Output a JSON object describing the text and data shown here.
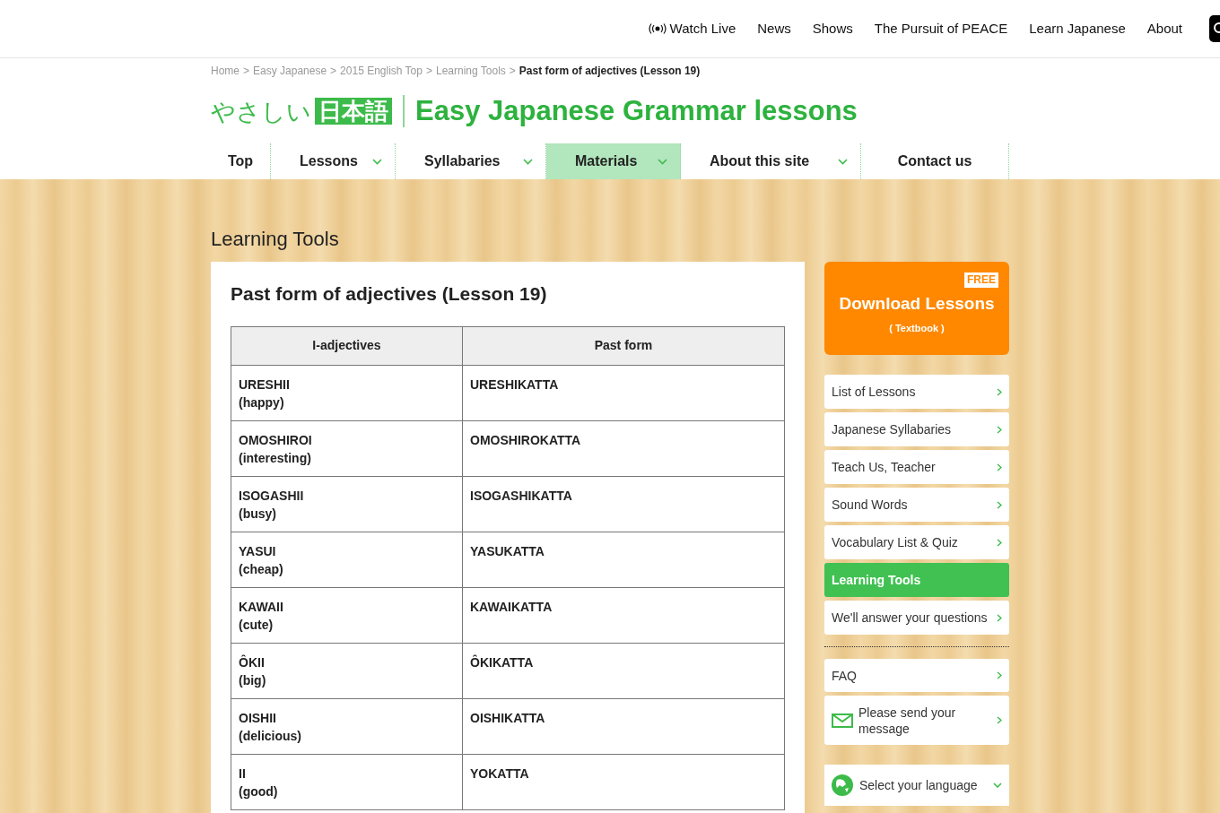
{
  "top_nav": {
    "items": [
      {
        "label": "Watch Live",
        "kind": "live"
      },
      {
        "label": "News",
        "kind": "plain"
      },
      {
        "label": "Shows",
        "kind": "plain"
      },
      {
        "label": "The Pursuit of PEACE",
        "kind": "plain"
      },
      {
        "label": "Learn Japanese",
        "kind": "plain"
      },
      {
        "label": "About",
        "kind": "plain"
      }
    ]
  },
  "breadcrumb": {
    "links": [
      "Home",
      "Easy Japanese",
      "2015 English Top",
      "Learning Tools"
    ],
    "separator": ">",
    "current": "Past form of adjectives (Lesson 19)"
  },
  "logo": {
    "kana": "やさしい",
    "kanji": "日本語"
  },
  "site_title": "Easy Japanese Grammar lessons",
  "menu": [
    {
      "label": "Top",
      "has_dropdown": false,
      "selected": false
    },
    {
      "label": "Lessons",
      "has_dropdown": true,
      "selected": false
    },
    {
      "label": "Syllabaries",
      "has_dropdown": true,
      "selected": false
    },
    {
      "label": "Materials",
      "has_dropdown": true,
      "selected": true
    },
    {
      "label": "About this site",
      "has_dropdown": true,
      "selected": false
    },
    {
      "label": "Contact us",
      "has_dropdown": false,
      "selected": false
    }
  ],
  "section_title": "Learning Tools",
  "article": {
    "title": "Past form of adjectives (Lesson 19)",
    "table": {
      "columns": [
        "I-adjectives",
        "Past form"
      ],
      "rows": [
        {
          "word": "URESHII",
          "meaning": "(happy)",
          "past": "URESHIKATTA"
        },
        {
          "word": "OMOSHIROI",
          "meaning": "(interesting)",
          "past": "OMOSHIROKATTA"
        },
        {
          "word": "ISOGASHII",
          "meaning": "(busy)",
          "past": "ISOGASHIKATTA"
        },
        {
          "word": "YASUI",
          "meaning": "(cheap)",
          "past": "YASUKATTA"
        },
        {
          "word": "KAWAII",
          "meaning": "(cute)",
          "past": "KAWAIKATTA"
        },
        {
          "word": "ÔKII",
          "meaning": "(big)",
          "past": "ÔKIKATTA"
        },
        {
          "word": "OISHII",
          "meaning": "(delicious)",
          "past": "OISHIKATTA"
        },
        {
          "word": "II",
          "meaning": "(good)",
          "past": "YOKATTA"
        }
      ]
    }
  },
  "sidebar": {
    "download": {
      "badge": "FREE",
      "title": "Download Lessons",
      "subtitle": "( Textbook )"
    },
    "items": [
      {
        "label": "List of Lessons",
        "selected": false
      },
      {
        "label": "Japanese Syllabaries",
        "selected": false
      },
      {
        "label": "Teach Us, Teacher",
        "selected": false
      },
      {
        "label": "Sound Words",
        "selected": false
      },
      {
        "label": "Vocabulary List & Quiz",
        "selected": false
      },
      {
        "label": "Learning Tools",
        "selected": true
      },
      {
        "label": "We'll answer your questions",
        "selected": false
      }
    ],
    "support": [
      {
        "label": "FAQ",
        "kind": "plain"
      },
      {
        "label": "Please send your message",
        "kind": "mail"
      }
    ],
    "language": {
      "label": "Select your language"
    }
  }
}
